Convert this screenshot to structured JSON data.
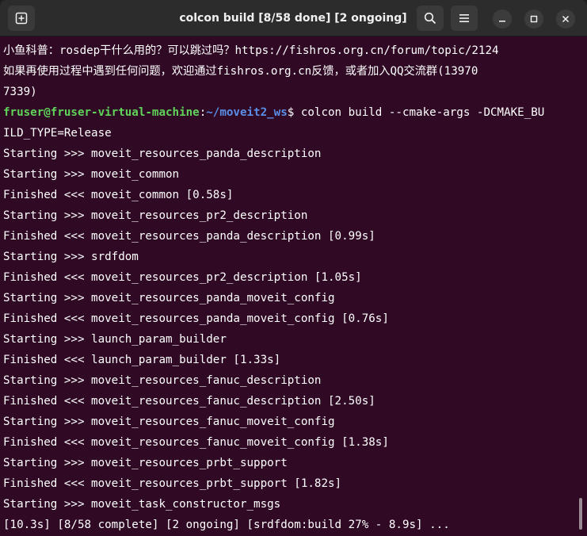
{
  "window": {
    "title": "colcon build [8/58 done] [2 ongoing]"
  },
  "icons": {
    "new_tab": "new-tab-icon",
    "search": "search-icon",
    "menu": "hamburger-menu-icon",
    "minimize": "minimize-icon",
    "maximize": "maximize-icon",
    "close": "close-icon"
  },
  "colors": {
    "terminal_bg": "#300a24",
    "prompt_user": "#5fd35a",
    "prompt_path": "#5a8ee8",
    "text": "#ffffff"
  },
  "terminal": {
    "intro": [
      "小鱼科普：rosdep干什么用的？可以跳过吗？https://fishros.org.cn/forum/topic/2124",
      "如果再使用过程中遇到任何问题，欢迎通过fishros.org.cn反馈，或者加入QQ交流群(13970",
      "7339)"
    ],
    "prompt": {
      "user_host": "fruser@fruser-virtual-machine",
      "colon": ":",
      "path": "~/moveit2_ws",
      "command": "$ colcon build --cmake-args -DCMAKE_BU"
    },
    "command_wrap": "ILD_TYPE=Release",
    "output": [
      "Starting >>> moveit_resources_panda_description",
      "Starting >>> moveit_common",
      "Finished <<< moveit_common [0.58s]",
      "Starting >>> moveit_resources_pr2_description",
      "Finished <<< moveit_resources_panda_description [0.99s]",
      "Starting >>> srdfdom",
      "Finished <<< moveit_resources_pr2_description [1.05s]",
      "Starting >>> moveit_resources_panda_moveit_config",
      "Finished <<< moveit_resources_panda_moveit_config [0.76s]",
      "Starting >>> launch_param_builder",
      "Finished <<< launch_param_builder [1.33s]",
      "Starting >>> moveit_resources_fanuc_description",
      "Finished <<< moveit_resources_fanuc_description [2.50s]",
      "Starting >>> moveit_resources_fanuc_moveit_config",
      "Finished <<< moveit_resources_fanuc_moveit_config [1.38s]",
      "Starting >>> moveit_resources_prbt_support",
      "Finished <<< moveit_resources_prbt_support [1.82s]",
      "Starting >>> moveit_task_constructor_msgs"
    ],
    "status": "[10.3s] [8/58 complete] [2 ongoing] [srdfdom:build 27% - 8.9s] ..."
  }
}
